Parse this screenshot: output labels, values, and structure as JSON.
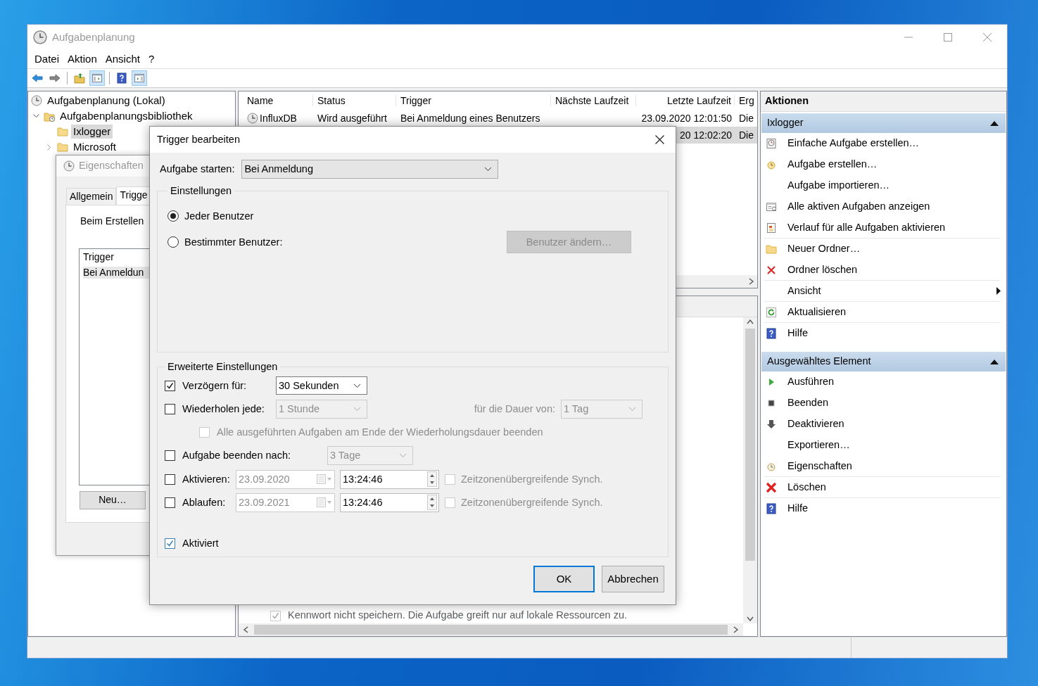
{
  "window": {
    "title": "Aufgabenplanung"
  },
  "menu": [
    {
      "label": "Datei"
    },
    {
      "label": "Aktion"
    },
    {
      "label": "Ansicht"
    },
    {
      "label": "?"
    }
  ],
  "toolbar": [
    {
      "kind": "back",
      "pressed": false
    },
    {
      "kind": "forward",
      "pressed": false,
      "separator_after": true
    },
    {
      "kind": "folder-up",
      "pressed": false
    },
    {
      "kind": "console-tree",
      "pressed": true,
      "separator_after": true
    },
    {
      "kind": "help",
      "pressed": false
    },
    {
      "kind": "action-pane",
      "pressed": true
    }
  ],
  "tree": [
    {
      "label": "Aufgabenplanung (Lokal)",
      "kind": "clock",
      "selected": false,
      "children": [
        {
          "label": "Aufgabenplanungsbibliothek",
          "kind": "library",
          "selected": false,
          "expanded": true,
          "children": [
            {
              "label": "Ixlogger",
              "kind": "folder",
              "selected": true
            },
            {
              "label": "Microsoft",
              "kind": "folder",
              "selected": false,
              "expanded": false
            }
          ]
        }
      ]
    }
  ],
  "tasks": {
    "columns": [
      {
        "label": "Name"
      },
      {
        "label": "Status"
      },
      {
        "label": "Trigger"
      },
      {
        "label": "Nächste Laufzeit"
      },
      {
        "label": "Letzte Laufzeit"
      },
      {
        "label": "Erg"
      }
    ],
    "rows": [
      {
        "selected": false,
        "name": "InfluxDB",
        "status": "Wird ausgeführt",
        "trigger": "Bei Anmeldung eines Benutzers",
        "last_run": "23.09.2020 12:01:50",
        "column_6": "Die"
      },
      {
        "selected": true,
        "last_run": "20 12:02:20",
        "column_6": "Die"
      }
    ]
  },
  "details": {
    "option": {
      "label": "Kennwort nicht speichern. Die Aufgabe greift nur auf lokale Ressourcen zu.",
      "checked": true,
      "disabled": true
    }
  },
  "properties_dialog": {
    "title": "Eigenschaften",
    "tabs": [
      {
        "label": "Allgemein",
        "selected": false
      },
      {
        "label": "Trigge",
        "selected": true
      }
    ],
    "description": "Beim Erstellen",
    "list_header": "Trigger",
    "list_rows": [
      {
        "text": "Bei Anmeldun",
        "selected": true
      }
    ],
    "new_button": "Neu…"
  },
  "trigger_dialog": {
    "title": "Trigger bearbeiten",
    "start_label": "Aufgabe starten:",
    "start_value": "Bei Anmeldung",
    "settings": {
      "legend": "Einstellungen",
      "options": [
        {
          "label": "Jeder Benutzer",
          "selected": true
        },
        {
          "label": "Bestimmter Benutzer:",
          "selected": false
        }
      ],
      "change_user": {
        "label": "Benutzer ändern…",
        "disabled": true
      }
    },
    "advanced": {
      "legend": "Erweiterte Einstellungen",
      "delay": {
        "label": "Verzögern für:",
        "checked": true,
        "value": "30 Sekunden",
        "disabled": false
      },
      "repeat": {
        "label": "Wiederholen jede:",
        "checked": false,
        "value": "1 Stunde",
        "disabled": true,
        "duration_label": "für die Dauer von:",
        "duration_value": "1 Tag"
      },
      "stop_all": {
        "label": "Alle ausgeführten Aufgaben am Ende der Wiederholungsdauer beenden",
        "checked": false,
        "disabled": true
      },
      "stop_after": {
        "label": "Aufgabe beenden nach:",
        "checked": false,
        "value": "3 Tage",
        "disabled": true
      },
      "activate": {
        "label": "Aktivieren:",
        "checked": false,
        "date": "23.09.2020",
        "time": "13:24:46",
        "sync_label": "Zeitzonenübergreifende Synch.",
        "sync_checked": false,
        "disabled": true
      },
      "expire": {
        "label": "Ablaufen:",
        "checked": false,
        "date": "23.09.2021",
        "time": "13:24:46",
        "sync_label": "Zeitzonenübergreifende Synch.",
        "sync_checked": false,
        "disabled": true
      },
      "enabled": {
        "label": "Aktiviert",
        "checked": true
      }
    },
    "buttons": [
      {
        "label": "OK",
        "default": true
      },
      {
        "label": "Abbrechen",
        "default": false
      }
    ]
  },
  "actions": {
    "title": "Aktionen",
    "sections": [
      {
        "title": "Ixlogger",
        "expanded": true,
        "items": [
          {
            "label": "Einfache Aufgabe erstellen…",
            "kind": "wizard"
          },
          {
            "label": "Aufgabe erstellen…",
            "kind": "task"
          },
          {
            "label": "Aufgabe importieren…",
            "kind": "plain"
          },
          {
            "label": "Alle aktiven Aufgaben anzeigen",
            "kind": "list"
          },
          {
            "label": "Verlauf für alle Aufgaben aktivieren",
            "kind": "log",
            "separator_after": true
          },
          {
            "label": "Neuer Ordner…",
            "kind": "folder"
          },
          {
            "label": "Ordner löschen",
            "kind": "delete",
            "separator_after": true
          },
          {
            "label": "Ansicht",
            "kind": "submenu",
            "separator_after": true
          },
          {
            "label": "Aktualisieren",
            "kind": "refresh",
            "separator_after": true
          },
          {
            "label": "Hilfe",
            "kind": "help"
          }
        ]
      },
      {
        "title": "Ausgewähltes Element",
        "expanded": true,
        "items": [
          {
            "label": "Ausführen",
            "kind": "run"
          },
          {
            "label": "Beenden",
            "kind": "stop"
          },
          {
            "label": "Deaktivieren",
            "kind": "disable"
          },
          {
            "label": "Exportieren…",
            "kind": "plain"
          },
          {
            "label": "Eigenschaften",
            "kind": "properties",
            "separator_after": true
          },
          {
            "label": "Löschen",
            "kind": "delete-large",
            "separator_after": true
          },
          {
            "label": "Hilfe",
            "kind": "help"
          }
        ]
      }
    ]
  }
}
